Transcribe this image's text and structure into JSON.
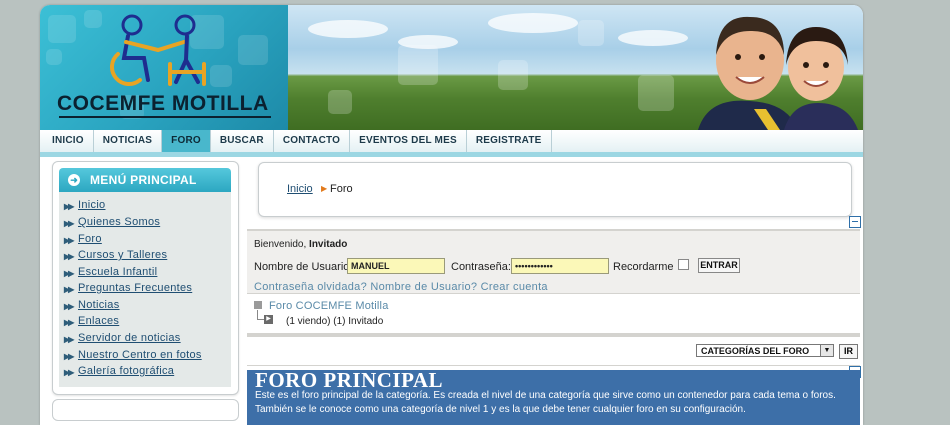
{
  "header": {
    "logo_text": "COCEMFE MOTILLA"
  },
  "nav": {
    "items": [
      {
        "label": "INICIO"
      },
      {
        "label": "NOTICIAS"
      },
      {
        "label": "FORO"
      },
      {
        "label": "BUSCAR"
      },
      {
        "label": "CONTACTO"
      },
      {
        "label": "EVENTOS DEL MES"
      },
      {
        "label": "REGISTRATE"
      }
    ],
    "active": "FORO"
  },
  "sidebar": {
    "title": "MENÚ PRINCIPAL",
    "items": [
      {
        "label": "Inicio"
      },
      {
        "label": "Quienes Somos"
      },
      {
        "label": "Foro"
      },
      {
        "label": "Cursos y Talleres"
      },
      {
        "label": "Escuela Infantil"
      },
      {
        "label": "Preguntas Frecuentes"
      },
      {
        "label": "Noticias"
      },
      {
        "label": "Enlaces"
      },
      {
        "label": "Servidor de noticias"
      },
      {
        "label": "Nuestro Centro en fotos"
      },
      {
        "label": "Galería fotográfica"
      }
    ]
  },
  "breadcrumb": {
    "home": "Inicio",
    "current": "Foro"
  },
  "login": {
    "welcome_prefix": "Bienvenido,",
    "welcome_user": "Invitado",
    "username_label": "Nombre de Usuario",
    "username_value": "MANUEL",
    "password_label": "Contraseña:",
    "password_value": "••••••••••••",
    "remember_label": "Recordarme",
    "enter_button": "ENTRAR",
    "forgot_password": "Contraseña olvidada?",
    "forgot_username": "Nombre de Usuario?",
    "create_account": "Crear cuenta"
  },
  "forum": {
    "link": "Foro COCEMFE Motilla",
    "viewers": "(1 viendo) (1) Invitado",
    "jump_select": "CATEGORÍAS DEL FORO",
    "go_button": "IR",
    "main_title": "FORO PRINCIPAL",
    "main_desc": "Este es el foro principal de la categoría. Es creada el nivel de una categoría que sirve como un contenedor para cada tema o foros.",
    "main_desc2": "También se le conoce como una categoría de nivel 1 y es la que debe tener cualquier foro en su configuración."
  },
  "colors": {
    "accent": "#2ca7c1",
    "nav_active": "#49b7cc",
    "link": "#1f4e72",
    "forum_panel": "#3d6fa8",
    "input_bg": "#fbf8b8"
  }
}
